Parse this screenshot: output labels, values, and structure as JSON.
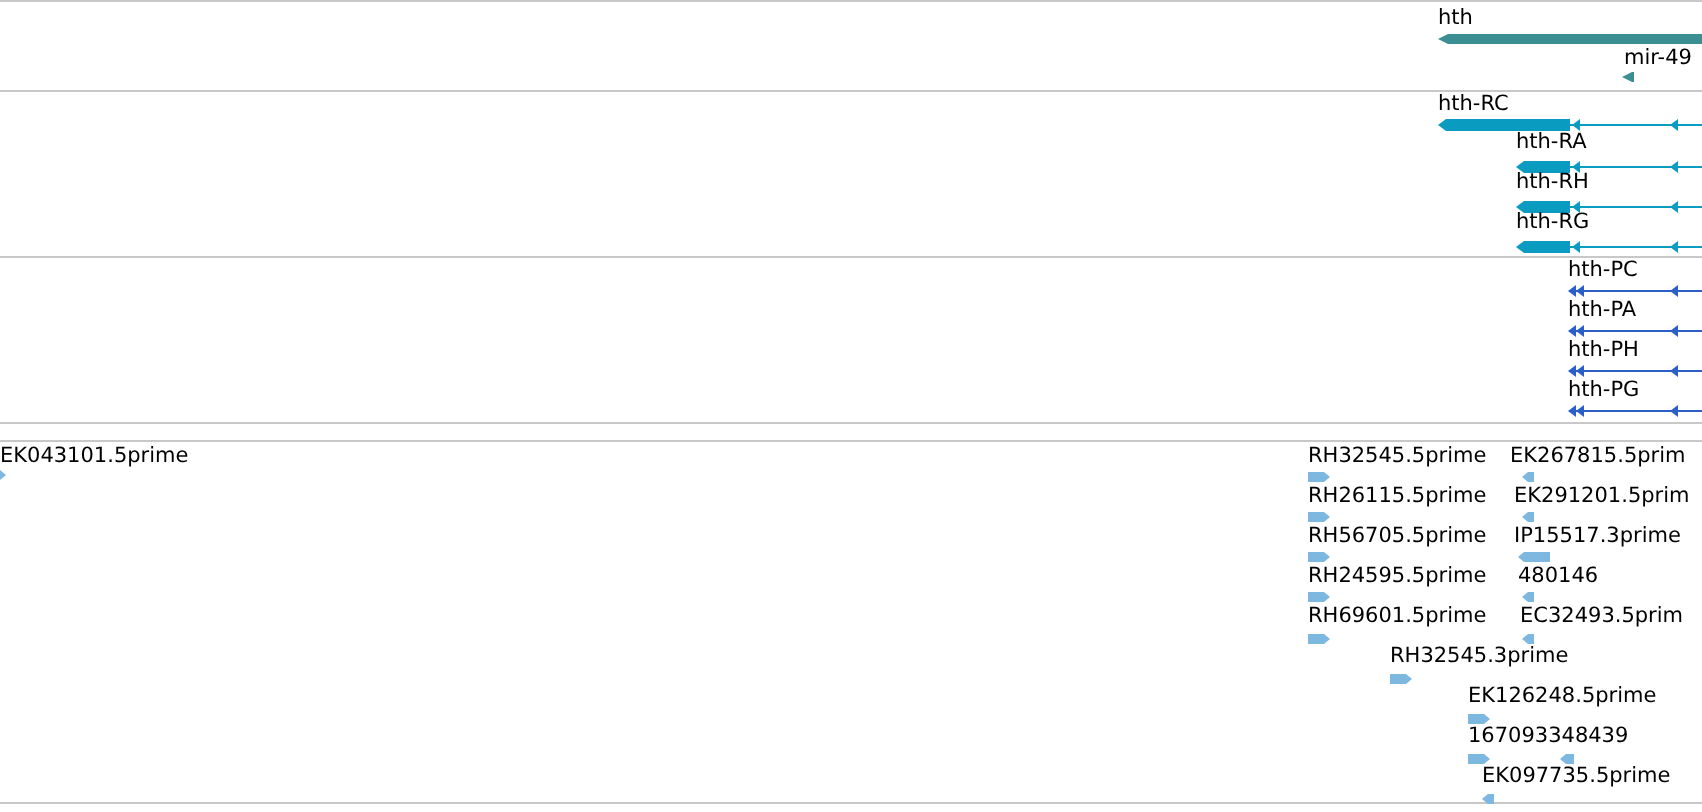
{
  "tracks": [
    {
      "kind": "gene",
      "features": [
        {
          "label": "hth",
          "reverse": true
        },
        {
          "label": "mir-49",
          "reverse": true
        }
      ]
    },
    {
      "kind": "transcript",
      "features": [
        {
          "label": "hth-RC",
          "reverse": true
        },
        {
          "label": "hth-RA",
          "reverse": true
        },
        {
          "label": "hth-RH",
          "reverse": true
        },
        {
          "label": "hth-RG",
          "reverse": true
        }
      ]
    },
    {
      "kind": "cds",
      "features": [
        {
          "label": "hth-PC",
          "reverse": true
        },
        {
          "label": "hth-PA",
          "reverse": true
        },
        {
          "label": "hth-PH",
          "reverse": true
        },
        {
          "label": "hth-PG",
          "reverse": true
        }
      ]
    },
    {
      "kind": "est",
      "features": [
        {
          "label": "EK043101.5prime",
          "reverse": false
        },
        {
          "label": "RH32545.5prime",
          "reverse": false
        },
        {
          "label": "EK267815.5prim",
          "reverse": true
        },
        {
          "label": "RH26115.5prime",
          "reverse": false
        },
        {
          "label": "EK291201.5prim",
          "reverse": true
        },
        {
          "label": "RH56705.5prime",
          "reverse": false
        },
        {
          "label": "IP15517.3prime",
          "reverse": true
        },
        {
          "label": "RH24595.5prime",
          "reverse": false
        },
        {
          "label": "480146",
          "reverse": true
        },
        {
          "label": "RH69601.5prime",
          "reverse": false
        },
        {
          "label": "EC32493.5prim",
          "reverse": true
        },
        {
          "label": "RH32545.3prime",
          "reverse": false
        },
        {
          "label": "EK126248.5prime",
          "reverse": false
        },
        {
          "label": "167093348439",
          "reverse": false
        },
        {
          "reverse": true
        },
        {
          "label": "EK097735.5prime",
          "reverse": true
        }
      ]
    }
  ]
}
